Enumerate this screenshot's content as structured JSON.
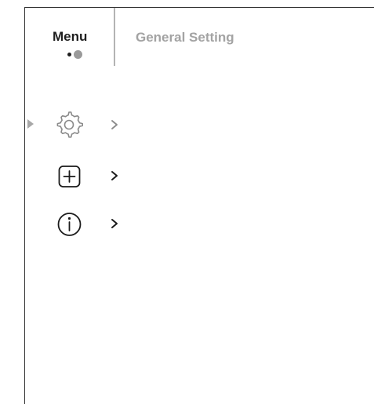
{
  "header": {
    "tabs": [
      {
        "label": "Menu",
        "active": true
      },
      {
        "label": "General Setting",
        "active": false
      }
    ],
    "pager": {
      "current_page": 2,
      "total_pages": 2
    }
  },
  "menu": {
    "selected_index": 0,
    "items": [
      {
        "icon": "gear-icon",
        "chevron": "chevron-right-icon",
        "selected": true
      },
      {
        "icon": "plus-square-icon",
        "chevron": "chevron-right-icon",
        "selected": false
      },
      {
        "icon": "info-circle-icon",
        "chevron": "chevron-right-icon",
        "selected": false
      }
    ]
  },
  "colors": {
    "background": "#ffffff",
    "text_active": "#1f1f1f",
    "text_inactive": "#a3a3a3",
    "icon_selected": "#8a8a8a",
    "icon_normal": "#1a1a1a",
    "cursor": "#a8a8a8",
    "divider": "#b3b3b3"
  }
}
